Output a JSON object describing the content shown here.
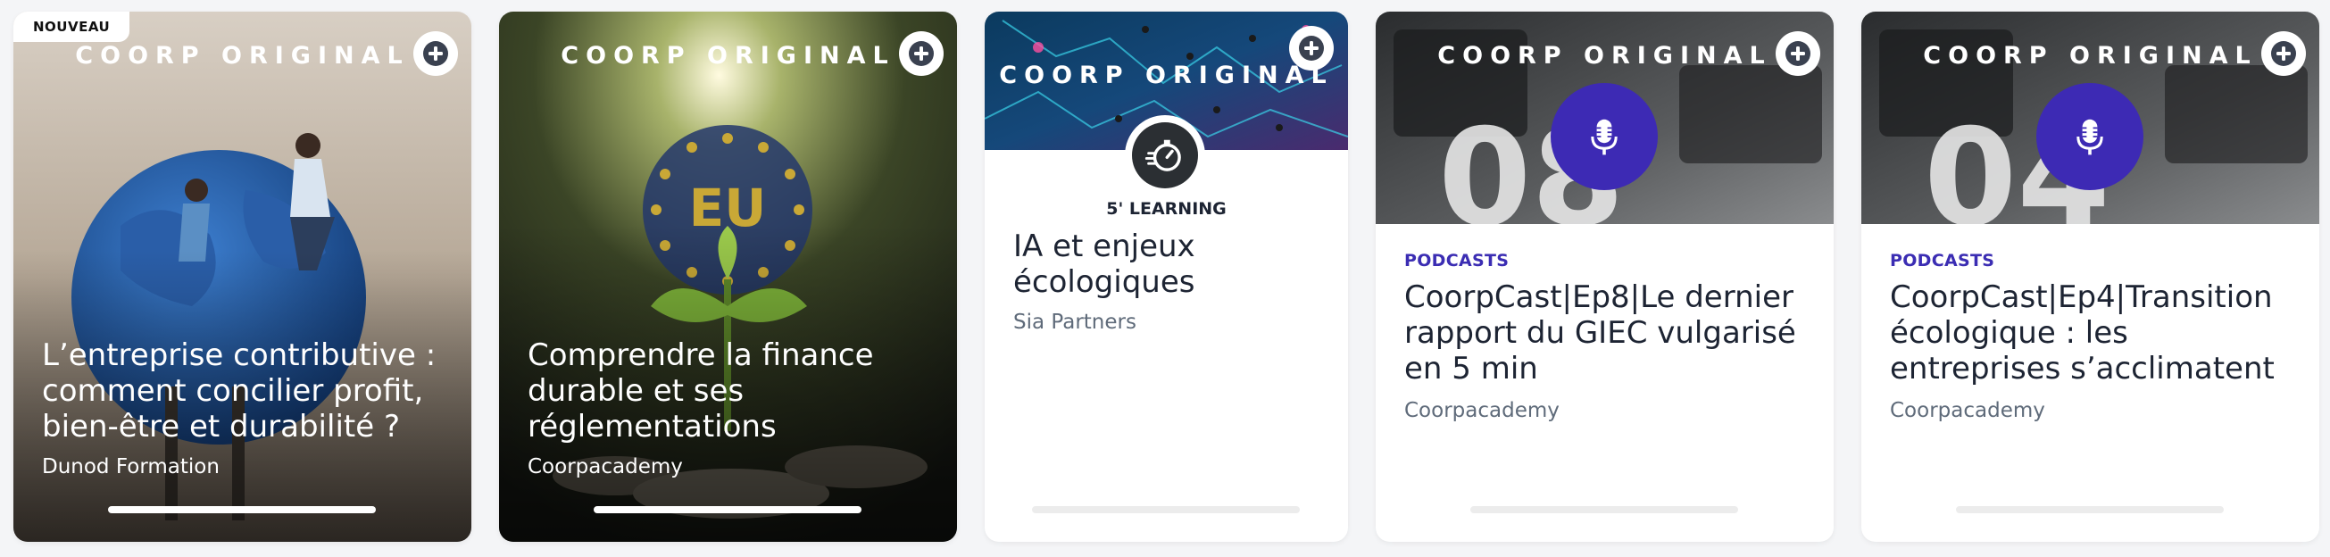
{
  "cards": [
    {
      "badge": "NOUVEAU",
      "brand": "COORP ORIGINAL",
      "title": "L’entreprise contributive : comment concilier profit, bien-être et durabilité ?",
      "author": "Dunod Formation"
    },
    {
      "brand": "COORP ORIGINAL",
      "title": "Comprendre la finance durable et ses réglementations",
      "author": "Coorpacademy",
      "image_text": "EU"
    },
    {
      "brand": "COORP ORIGINAL",
      "type": "5' LEARNING",
      "title": "IA et enjeux écologiques",
      "author": "Sia Partners"
    },
    {
      "brand": "COORP ORIGINAL",
      "type": "PODCASTS",
      "title": "CoorpCast|Ep8|Le dernier rapport du GIEC vulgarisé en 5 min",
      "author": "Coorpacademy",
      "image_text": "08"
    },
    {
      "brand": "COORP ORIGINAL",
      "type": "PODCASTS",
      "title": "CoorpCast|Ep4|Transition écologique : les entreprises s’acclimatent",
      "author": "Coorpacademy",
      "image_text": "04"
    }
  ],
  "icons": {
    "add": "plus-circle-icon",
    "podcast": "microphone-icon",
    "learning": "stopwatch-icon"
  },
  "colors": {
    "podcast_accent": "#3d2ab4",
    "title_text": "#1d2433",
    "author_text": "#5f6b7a"
  }
}
